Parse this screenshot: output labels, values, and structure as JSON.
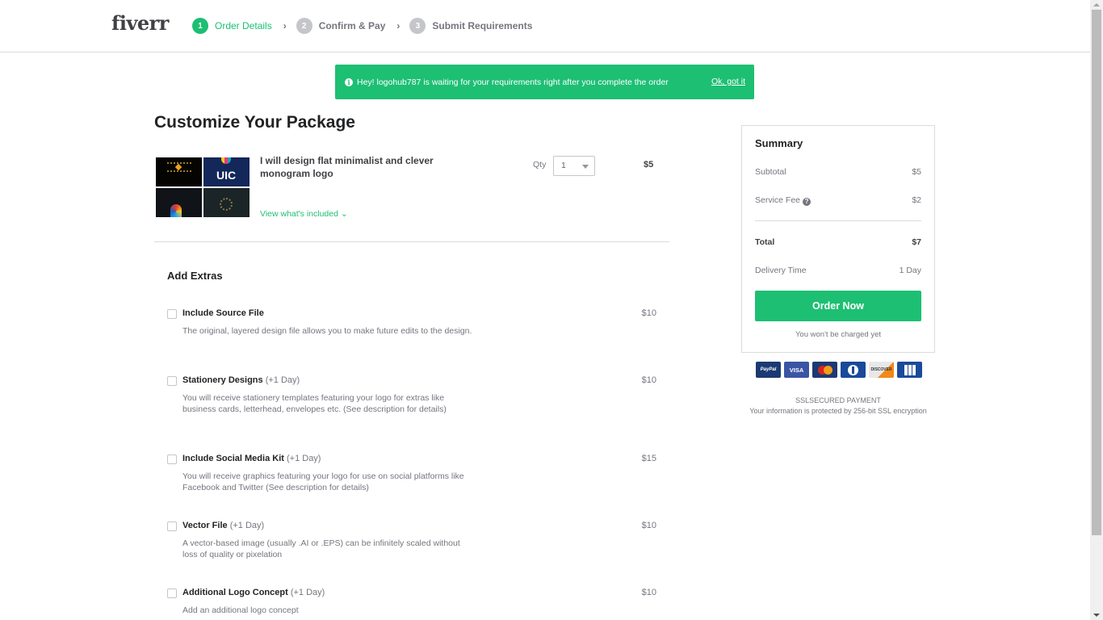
{
  "header": {
    "logo": "fiverr",
    "steps": [
      {
        "number": "1",
        "label": "Order Details",
        "active": true
      },
      {
        "number": "2",
        "label": "Confirm & Pay",
        "active": false
      },
      {
        "number": "3",
        "label": "Submit Requirements",
        "active": false
      }
    ],
    "step_separator": "›"
  },
  "banner": {
    "icon": "info-icon",
    "icon_glyph": "i",
    "message": "Hey! logohub787 is waiting for your requirements right after you complete the order",
    "dismiss_label": "Ok, got it"
  },
  "main": {
    "title": "Customize Your Package",
    "gig": {
      "thumbnail_text": "UIC",
      "title": "I will design flat minimalist and clever monogram logo",
      "view_included_label": "View what's included ⌄",
      "qty_label": "Qty",
      "qty_value": "1",
      "price": "$5"
    },
    "extras_title": "Add Extras",
    "extras": [
      {
        "name": "Include Source File",
        "days": "",
        "price": "$10",
        "checked": false,
        "description": "The original, layered design file allows you to make future edits to the design."
      },
      {
        "name": "Stationery Designs",
        "days": "(+1 Day)",
        "price": "$10",
        "checked": false,
        "description": "You will receive stationery templates featuring your logo for extras like business cards, letterhead, envelopes etc. (See description for details)"
      },
      {
        "name": "Include Social Media Kit",
        "days": "(+1 Day)",
        "price": "$15",
        "checked": false,
        "description": "You will receive graphics featuring your logo for use on social platforms like Facebook and Twitter (See description for details)"
      },
      {
        "name": "Vector File",
        "days": "(+1 Day)",
        "price": "$10",
        "checked": false,
        "description": "A vector-based image (usually .AI or .EPS) can be infinitely scaled without loss of quality or pixelation"
      },
      {
        "name": "Additional Logo Concept",
        "days": "(+1 Day)",
        "price": "$10",
        "checked": false,
        "description": "Add an additional logo concept"
      }
    ]
  },
  "summary": {
    "title": "Summary",
    "subtotal_label": "Subtotal",
    "subtotal_value": "$5",
    "service_fee_label": "Service Fee",
    "service_fee_value": "$2",
    "help_glyph": "?",
    "total_label": "Total",
    "total_value": "$7",
    "delivery_label": "Delivery Time",
    "delivery_value": "1 Day",
    "order_button": "Order Now",
    "not_charged": "You won't be charged yet"
  },
  "payment": {
    "cards": {
      "paypal": "PayPal",
      "visa": "VISA",
      "mastercard": "",
      "diners": "",
      "discover": "DISCOVER",
      "jcb": ""
    },
    "ssl_title": "SSLSECURED PAYMENT",
    "ssl_subtitle": "Your information is protected by 256-bit SSL encryption"
  },
  "colors": {
    "brand_green": "#1dbf73",
    "text_dark": "#222325",
    "text_muted": "#74767e"
  }
}
